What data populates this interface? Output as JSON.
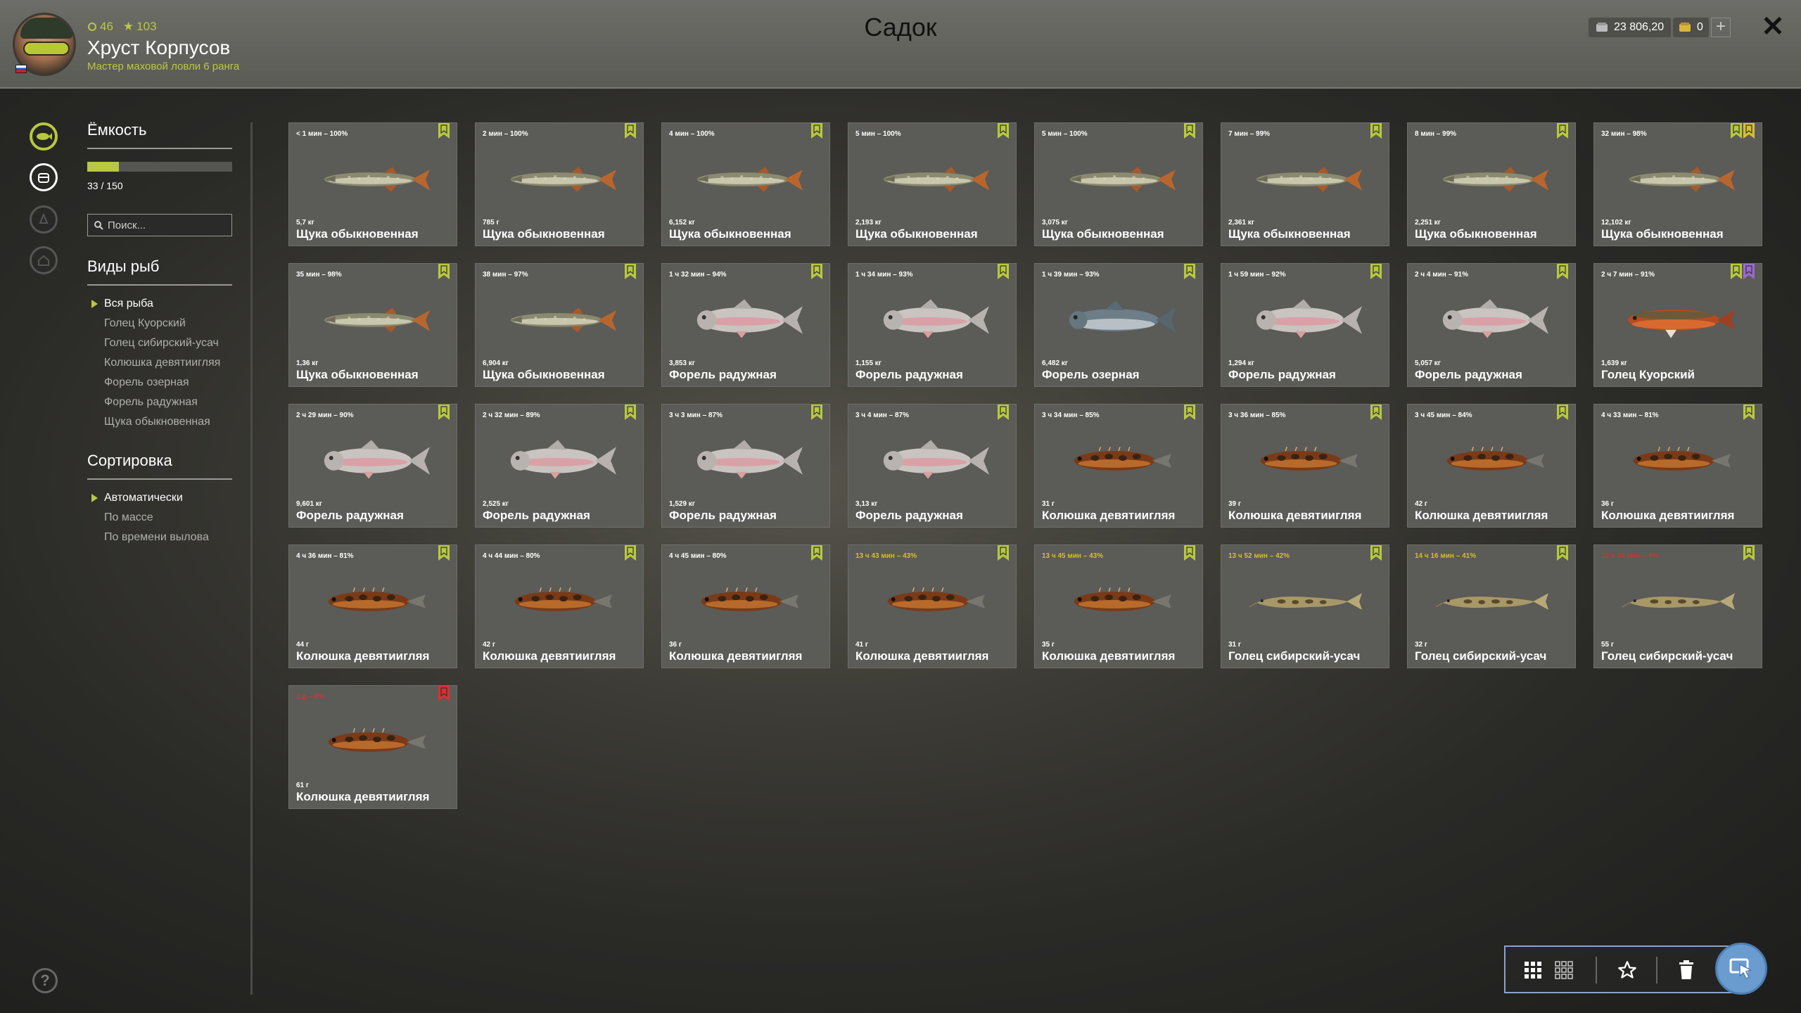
{
  "header": {
    "title": "Садок",
    "player": {
      "name": "Хруст Корпусов",
      "rank": "Мастер маховой ловли 6 ранга",
      "level": "46",
      "stars": "103"
    },
    "currency": {
      "silver": "23 806,20",
      "gold": "0"
    },
    "add_label": "+",
    "close_label": "✕"
  },
  "capacity": {
    "title": "Ёмкость",
    "value": "33 / 150",
    "fill_fraction": 0.22
  },
  "search": {
    "placeholder": "Поиск..."
  },
  "species": {
    "title": "Виды рыб",
    "items": [
      "Вся рыба",
      "Голец Куорский",
      "Голец сибирский-усач",
      "Колюшка девятиигляя",
      "Форель озерная",
      "Форель радужная",
      "Щука обыкновенная"
    ]
  },
  "sorting": {
    "title": "Сортировка",
    "items": [
      "Автоматически",
      "По массе",
      "По времени вылова"
    ]
  },
  "help_label": "?",
  "colors": {
    "accent": "#b8c840",
    "bookmark_green": "#b8c840",
    "bookmark_purple": "#9a6ad0",
    "bookmark_red": "#d83030",
    "toolbar_blue": "#6a9cd0"
  },
  "fish": [
    {
      "time": "< 1 мин – 100%",
      "weight": "5,7 кг",
      "name": "Щука обыкновенная",
      "type": "pike",
      "bookmarks": [
        "green"
      ]
    },
    {
      "time": "2 мин – 100%",
      "weight": "785 г",
      "name": "Щука обыкновенная",
      "type": "pike",
      "bookmarks": [
        "green"
      ]
    },
    {
      "time": "4 мин – 100%",
      "weight": "6,152 кг",
      "name": "Щука обыкновенная",
      "type": "pike",
      "bookmarks": [
        "green"
      ]
    },
    {
      "time": "5 мин – 100%",
      "weight": "2,193 кг",
      "name": "Щука обыкновенная",
      "type": "pike",
      "bookmarks": [
        "green"
      ]
    },
    {
      "time": "5 мин – 100%",
      "weight": "3,075 кг",
      "name": "Щука обыкновенная",
      "type": "pike",
      "bookmarks": [
        "green"
      ]
    },
    {
      "time": "7 мин – 99%",
      "weight": "2,361 кг",
      "name": "Щука обыкновенная",
      "type": "pike",
      "bookmarks": [
        "green"
      ]
    },
    {
      "time": "8 мин – 99%",
      "weight": "2,251 кг",
      "name": "Щука обыкновенная",
      "type": "pike",
      "bookmarks": [
        "green"
      ]
    },
    {
      "time": "32 мин – 98%",
      "weight": "12,102 кг",
      "name": "Щука обыкновенная",
      "type": "pike",
      "bookmarks": [
        "green",
        "yellow"
      ]
    },
    {
      "time": "35 мин – 98%",
      "weight": "1,36 кг",
      "name": "Щука обыкновенная",
      "type": "pike",
      "bookmarks": [
        "green"
      ]
    },
    {
      "time": "38 мин – 97%",
      "weight": "6,904 кг",
      "name": "Щука обыкновенная",
      "type": "pike",
      "bookmarks": [
        "green"
      ]
    },
    {
      "time": "1 ч 32 мин – 94%",
      "weight": "3,853 кг",
      "name": "Форель радужная",
      "type": "trout",
      "bookmarks": [
        "green"
      ]
    },
    {
      "time": "1 ч 34 мин – 93%",
      "weight": "1,155 кг",
      "name": "Форель радужная",
      "type": "trout",
      "bookmarks": [
        "green"
      ]
    },
    {
      "time": "1 ч 39 мин – 93%",
      "weight": "6,482 кг",
      "name": "Форель озерная",
      "type": "laketrout",
      "bookmarks": [
        "green"
      ]
    },
    {
      "time": "1 ч 59 мин – 92%",
      "weight": "1,294 кг",
      "name": "Форель радужная",
      "type": "trout",
      "bookmarks": [
        "green"
      ]
    },
    {
      "time": "2 ч 4 мин – 91%",
      "weight": "5,057 кг",
      "name": "Форель радужная",
      "type": "trout",
      "bookmarks": [
        "green"
      ]
    },
    {
      "time": "2 ч 7 мин – 91%",
      "weight": "1,639 кг",
      "name": "Голец Куорский",
      "type": "char",
      "bookmarks": [
        "green",
        "purple"
      ]
    },
    {
      "time": "2 ч 29 мин – 90%",
      "weight": "9,601 кг",
      "name": "Форель радужная",
      "type": "trout",
      "bookmarks": [
        "green"
      ]
    },
    {
      "time": "2 ч 32 мин – 89%",
      "weight": "2,525 кг",
      "name": "Форель радужная",
      "type": "trout",
      "bookmarks": [
        "green"
      ]
    },
    {
      "time": "3 ч 3 мин – 87%",
      "weight": "1,529 кг",
      "name": "Форель радужная",
      "type": "trout",
      "bookmarks": [
        "green"
      ]
    },
    {
      "time": "3 ч 4 мин – 87%",
      "weight": "3,13 кг",
      "name": "Форель радужная",
      "type": "trout",
      "bookmarks": [
        "green"
      ]
    },
    {
      "time": "3 ч 34 мин – 85%",
      "weight": "31 г",
      "name": "Колюшка девятиигляя",
      "type": "stickleback",
      "bookmarks": [
        "green"
      ]
    },
    {
      "time": "3 ч 36 мин – 85%",
      "weight": "39 г",
      "name": "Колюшка девятиигляя",
      "type": "stickleback",
      "bookmarks": [
        "green"
      ]
    },
    {
      "time": "3 ч 45 мин – 84%",
      "weight": "42 г",
      "name": "Колюшка девятиигляя",
      "type": "stickleback",
      "bookmarks": [
        "green"
      ]
    },
    {
      "time": "4 ч 33 мин – 81%",
      "weight": "36 г",
      "name": "Колюшка девятиигляя",
      "type": "stickleback",
      "bookmarks": [
        "green"
      ]
    },
    {
      "time": "4 ч 36 мин – 81%",
      "weight": "44 г",
      "name": "Колюшка девятиигляя",
      "type": "stickleback",
      "bookmarks": [
        "green"
      ]
    },
    {
      "time": "4 ч 44 мин – 80%",
      "weight": "42 г",
      "name": "Колюшка девятиигляя",
      "type": "stickleback",
      "bookmarks": [
        "green"
      ]
    },
    {
      "time": "4 ч 45 мин – 80%",
      "weight": "36 г",
      "name": "Колюшка девятиигляя",
      "type": "stickleback",
      "bookmarks": [
        "green"
      ]
    },
    {
      "time": "13 ч 43 мин – 43%",
      "weight": "41 г",
      "name": "Колюшка девятиигляя",
      "type": "stickleback",
      "bookmarks": [
        "green"
      ],
      "status": "warn"
    },
    {
      "time": "13 ч 45 мин – 43%",
      "weight": "35 г",
      "name": "Колюшка девятиигляя",
      "type": "stickleback",
      "bookmarks": [
        "green"
      ],
      "status": "warn"
    },
    {
      "time": "13 ч 52 мин – 42%",
      "weight": "31 г",
      "name": "Голец сибирский-усач",
      "type": "loach",
      "bookmarks": [
        "green"
      ],
      "status": "warn"
    },
    {
      "time": "14 ч 16 мин – 41%",
      "weight": "32 г",
      "name": "Голец сибирский-усач",
      "type": "loach",
      "bookmarks": [
        "green"
      ],
      "status": "warn"
    },
    {
      "time": "22 ч 36 мин – 6%",
      "weight": "55 г",
      "name": "Голец сибирский-усач",
      "type": "loach",
      "bookmarks": [
        "green"
      ],
      "status": "bad"
    },
    {
      "time": "1 д – 0%",
      "weight": "61 г",
      "name": "Колюшка девятиигляя",
      "type": "stickleback",
      "bookmarks": [
        "red"
      ],
      "status": "bad"
    }
  ],
  "toolbar": {
    "buttons": [
      "grid-large-icon",
      "grid-small-icon",
      "star-icon",
      "trash-icon",
      "cursor-icon"
    ]
  }
}
